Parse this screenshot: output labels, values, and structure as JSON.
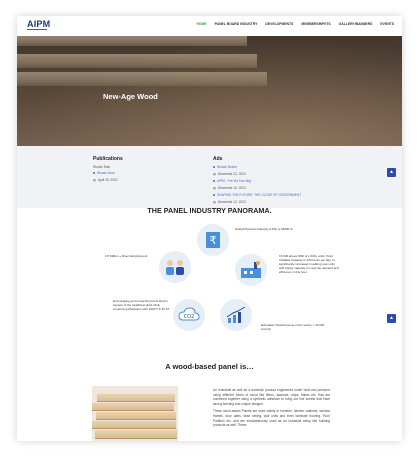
{
  "header": {
    "logo": "AIPM",
    "nav": [
      "HOME",
      "PANEL BOARD INDUSTRY",
      "DEVELOPMENTS",
      "MEMBERSHIP/ITS",
      "GALLERY/BANNERS",
      "EVENTS"
    ],
    "active_index": 0
  },
  "hero": {
    "title": "New-Age Wood"
  },
  "publications": {
    "title": "Publications",
    "sub": "Woods Rain",
    "items": [
      {
        "text": "Woods book",
        "date": "April 29, 2022"
      }
    ]
  },
  "ads": {
    "title": "Ads",
    "items": [
      {
        "text": "Woods Notice",
        "date": "December 22, 2022"
      },
      {
        "text": "AIPM - Pre Vid Live Mtg",
        "date": "December 10, 2022"
      },
      {
        "text": "SHAPING THE FUTURE: THE CLOSE OF GOVERNMENT",
        "date": "December 12, 2022"
      }
    ]
  },
  "panorama": {
    "title": "THE PANEL INDUSTRY PANORAMA.",
    "texts": {
      "top_right": "Global Plywood Capacity (LPH) is 18000 Cr.",
      "left_people": "2.5 Million + Direct Employment",
      "right_factory": "15,000 above MSF & 1,000+ units. Total Installed Capacity is 100 hours per day, to, significantly increased in adding new units with higher capacity to meet the demand and efficiency in this hour.",
      "left_co2": "Encouraging and protecting forest land in support of the healthiest plant while conserving Plantation with 1000 T & 25 KT",
      "bottom_right": "Estimated Total Revenue of the sector > 40 000 crore/yr"
    }
  },
  "wood": {
    "title": "A wood-based panel is…",
    "paragraph1": "An Industrial as well as a domestic product engineered under heat and pressure using different forms of wood like fibres, sawdust, chips, flakes etc. that are combined together using a synthetic adhesive to bring out fine sheets that have strong bonding and unique designs.",
    "paragraph2": "These wood-based Panels are used widely in furniture, kitchen cabinets, window frames, door parts, false ceiling, wall units and even laminate flooring. Floor Partition etc. and are simultaneously used as an industrial setup like building products as well. These"
  },
  "colors": {
    "brand": "#1b3a7a",
    "active": "#2f9e4f",
    "accent": "#2a4ea6",
    "link": "#3f6fd8"
  },
  "icons": {
    "currency": "rupee-icon",
    "people": "people-icon",
    "factory": "factory-icon",
    "co2": "co2-cloud-icon",
    "growth": "growth-chart-icon",
    "scroll": "chevron-up-icon"
  }
}
